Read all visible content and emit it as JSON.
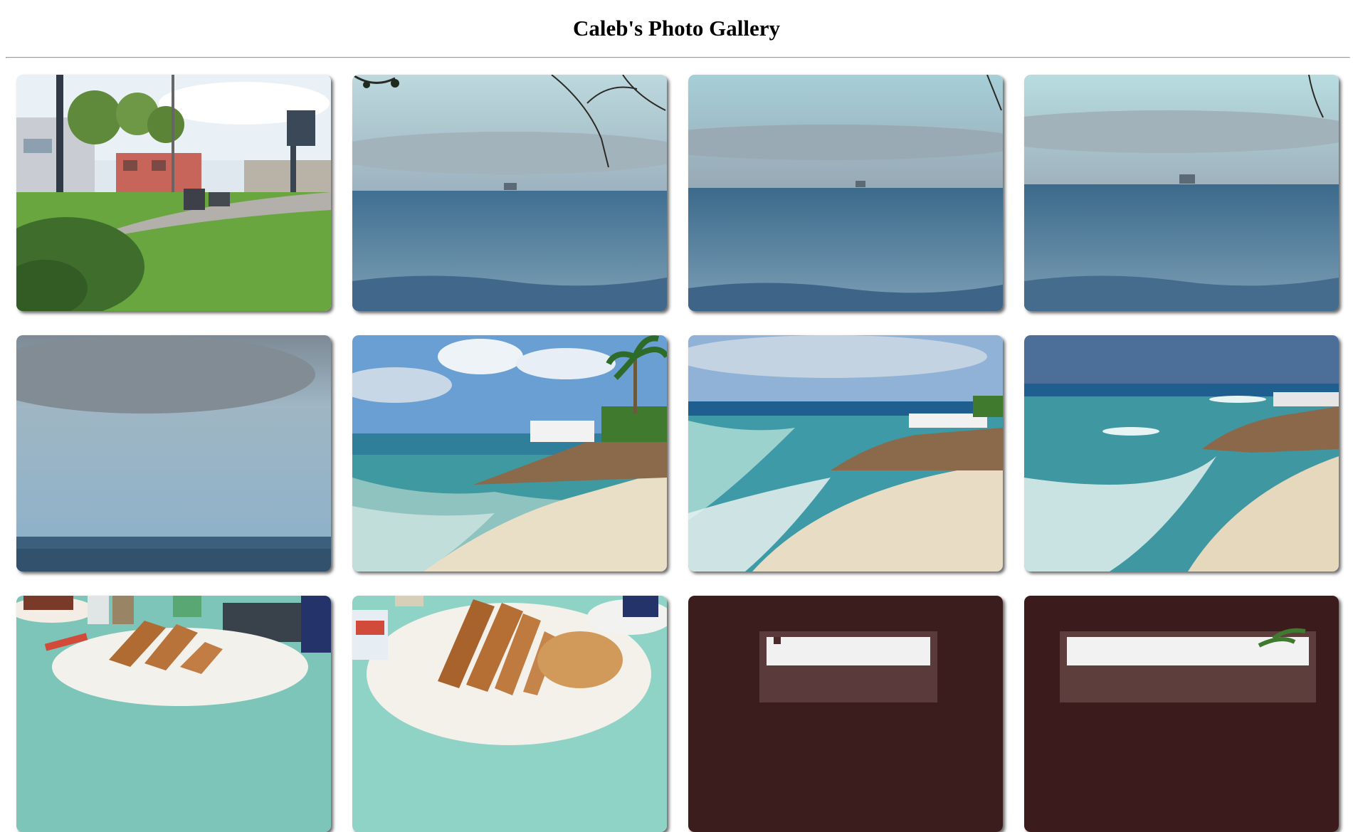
{
  "page": {
    "title": "Caleb's Photo Gallery"
  },
  "gallery": {
    "photos": [
      {
        "subject": "park",
        "description": "Park with lawn, trees, path and pink buildings"
      },
      {
        "subject": "sea-branch",
        "description": "Calm sea horizon with a distant ship and tree branch"
      },
      {
        "subject": "sea-horizon",
        "description": "Calm sea horizon with a distant ship"
      },
      {
        "subject": "sea-horizon-2",
        "description": "Calm sea horizon with a distant tall ship"
      },
      {
        "subject": "sky-blur",
        "description": "Blurred cloudy sky over sea"
      },
      {
        "subject": "beach-palm",
        "description": "Turquoise beach with rocks, railing and palm tree"
      },
      {
        "subject": "beach-rocks",
        "description": "Waves on a beach with rocky outcrop"
      },
      {
        "subject": "beach-rocks-2",
        "description": "Surf on sandy beach beside rocks"
      },
      {
        "subject": "breakfast",
        "description": "Breakfast table with toasted bread"
      },
      {
        "subject": "bread-plate",
        "description": "Plate of sliced bread"
      },
      {
        "subject": "dark-window",
        "description": "Dark frame with bright window"
      },
      {
        "subject": "dark-window-palm",
        "description": "Dark frame with window and palm"
      }
    ]
  }
}
